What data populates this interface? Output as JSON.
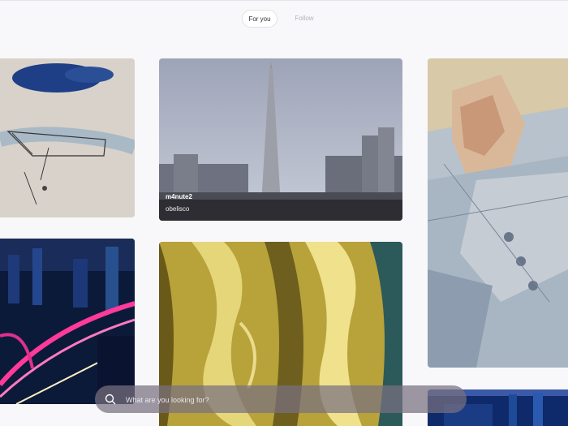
{
  "tabs": [
    {
      "label": "For you",
      "active": true
    },
    {
      "label": "Follow",
      "active": false
    }
  ],
  "cards": [
    {
      "name": "abstract-sketch"
    },
    {
      "name": "obelisco",
      "user": "m4nute2",
      "title": "obelisco"
    },
    {
      "name": "cubist-portrait"
    },
    {
      "name": "city-night"
    },
    {
      "name": "gold-liquid"
    },
    {
      "name": "city-lights-bottom"
    }
  ],
  "search": {
    "placeholder": "What are you looking for?"
  },
  "colors": {
    "background": "#f8f7fa",
    "search_bar": "#7b7282"
  }
}
